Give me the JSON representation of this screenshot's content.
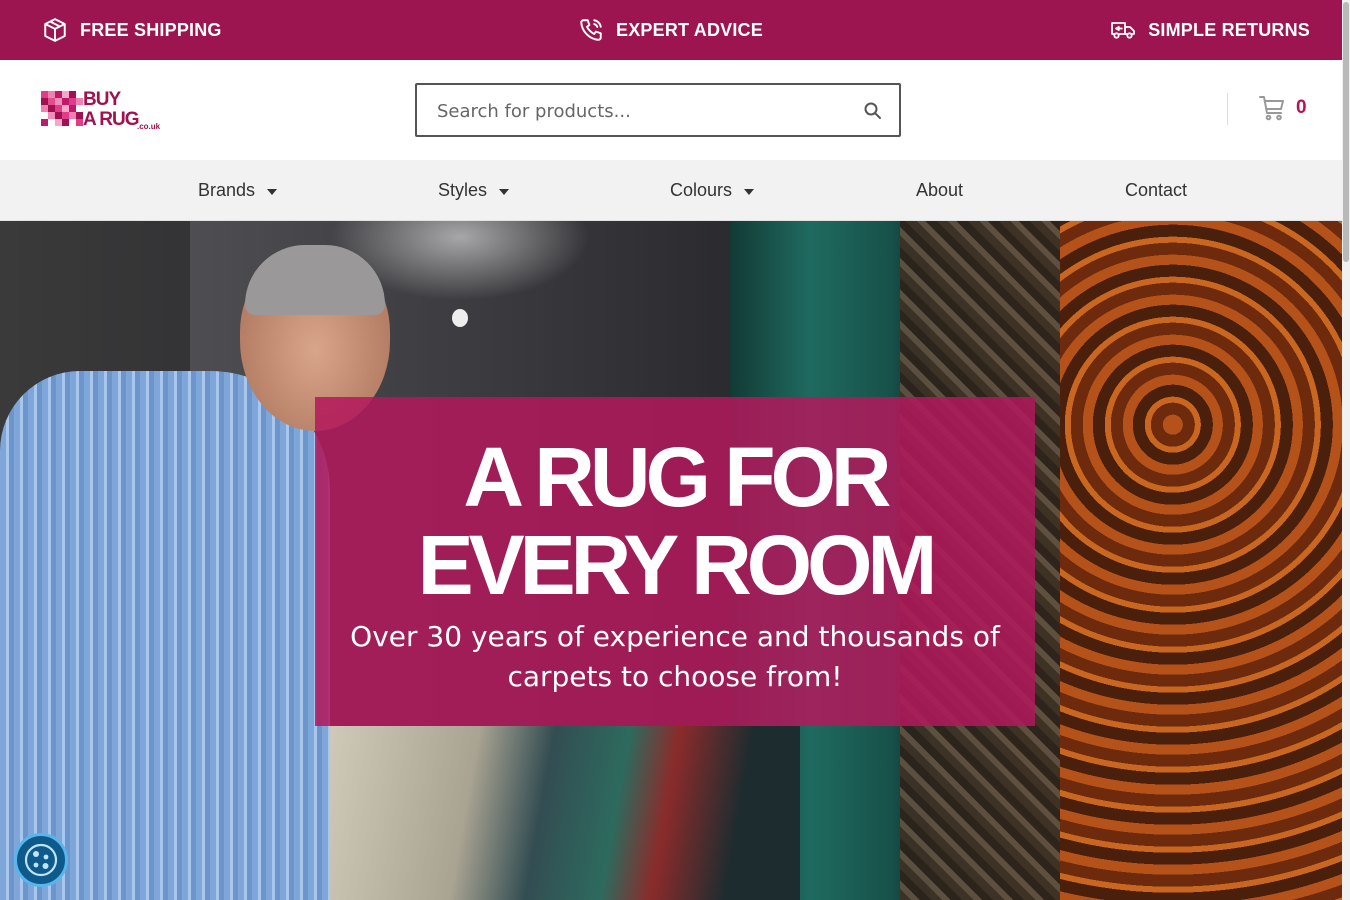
{
  "topbar": {
    "shipping": {
      "label": "FREE SHIPPING",
      "icon": "box-icon"
    },
    "advice": {
      "label": "EXPERT ADVICE",
      "icon": "phone-icon"
    },
    "returns": {
      "label": "SIMPLE RETURNS",
      "icon": "truck-icon"
    }
  },
  "header": {
    "logo": {
      "line1": "BUY",
      "line2": "A RUG",
      "suffix": ".co.uk"
    },
    "search": {
      "placeholder": "Search for products..."
    },
    "cart": {
      "count": "0"
    }
  },
  "nav": {
    "items": [
      {
        "label": "Brands",
        "dropdown": true
      },
      {
        "label": "Styles",
        "dropdown": true
      },
      {
        "label": "Colours",
        "dropdown": true
      },
      {
        "label": "About",
        "dropdown": false
      },
      {
        "label": "Contact",
        "dropdown": false
      }
    ]
  },
  "hero": {
    "title_line1": "A RUG FOR",
    "title_line2": "EVERY ROOM",
    "subtitle": "Over 30 years of experience and thousands of carpets to choose from!"
  },
  "colors": {
    "brand": "#9c1550",
    "accent": "#b5135c",
    "panel": "#b2185c",
    "cookie": "#0e5a8c"
  }
}
